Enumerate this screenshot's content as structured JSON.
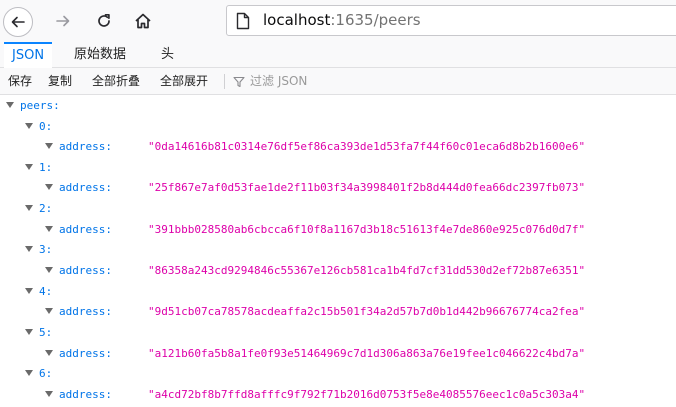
{
  "browser": {
    "url_host": "localhost",
    "url_rest": ":1635/peers"
  },
  "viewer": {
    "tabs": [
      "JSON",
      "原始数据",
      "头"
    ],
    "toolbar": {
      "save": "保存",
      "copy": "复制",
      "collapse_all": "全部折叠",
      "expand_all": "全部展开",
      "filter_placeholder": "过滤 JSON"
    }
  },
  "tree": {
    "root_key": "peers:",
    "field_key": "address:",
    "items": [
      {
        "index": "0:",
        "address": "\"0da14616b81c0314e76df5ef86ca393de1d53fa7f44f60c01eca6d8b2b1600e6\""
      },
      {
        "index": "1:",
        "address": "\"25f867e7af0d53fae1de2f11b03f34a3998401f2b8d444d0fea66dc2397fb073\""
      },
      {
        "index": "2:",
        "address": "\"391bbb028580ab6cbcca6f10f8a1167d3b18c51613f4e7de860e925c076d0d7f\""
      },
      {
        "index": "3:",
        "address": "\"86358a243cd9294846c55367e126cb581ca1b4fd7cf31dd530d2ef72b87e6351\""
      },
      {
        "index": "4:",
        "address": "\"9d51cb07ca78578acdeaffa2c15b501f34a2d57b7d0b1d442b96676774ca2fea\""
      },
      {
        "index": "5:",
        "address": "\"a121b60fa5b8a1fe0f93e51464969c7d1d306a863a76e19fee1c046622c4bd7a\""
      },
      {
        "index": "6:",
        "address": "\"a4cd72bf8b7ffd8afffc9f792f71b2016d0753f5e8e4085576eec1c0a5c303a4\""
      }
    ]
  },
  "colors": {
    "key": "#0074e8",
    "string_value": "#dd00a9",
    "active_tab": "#0a84ff"
  }
}
